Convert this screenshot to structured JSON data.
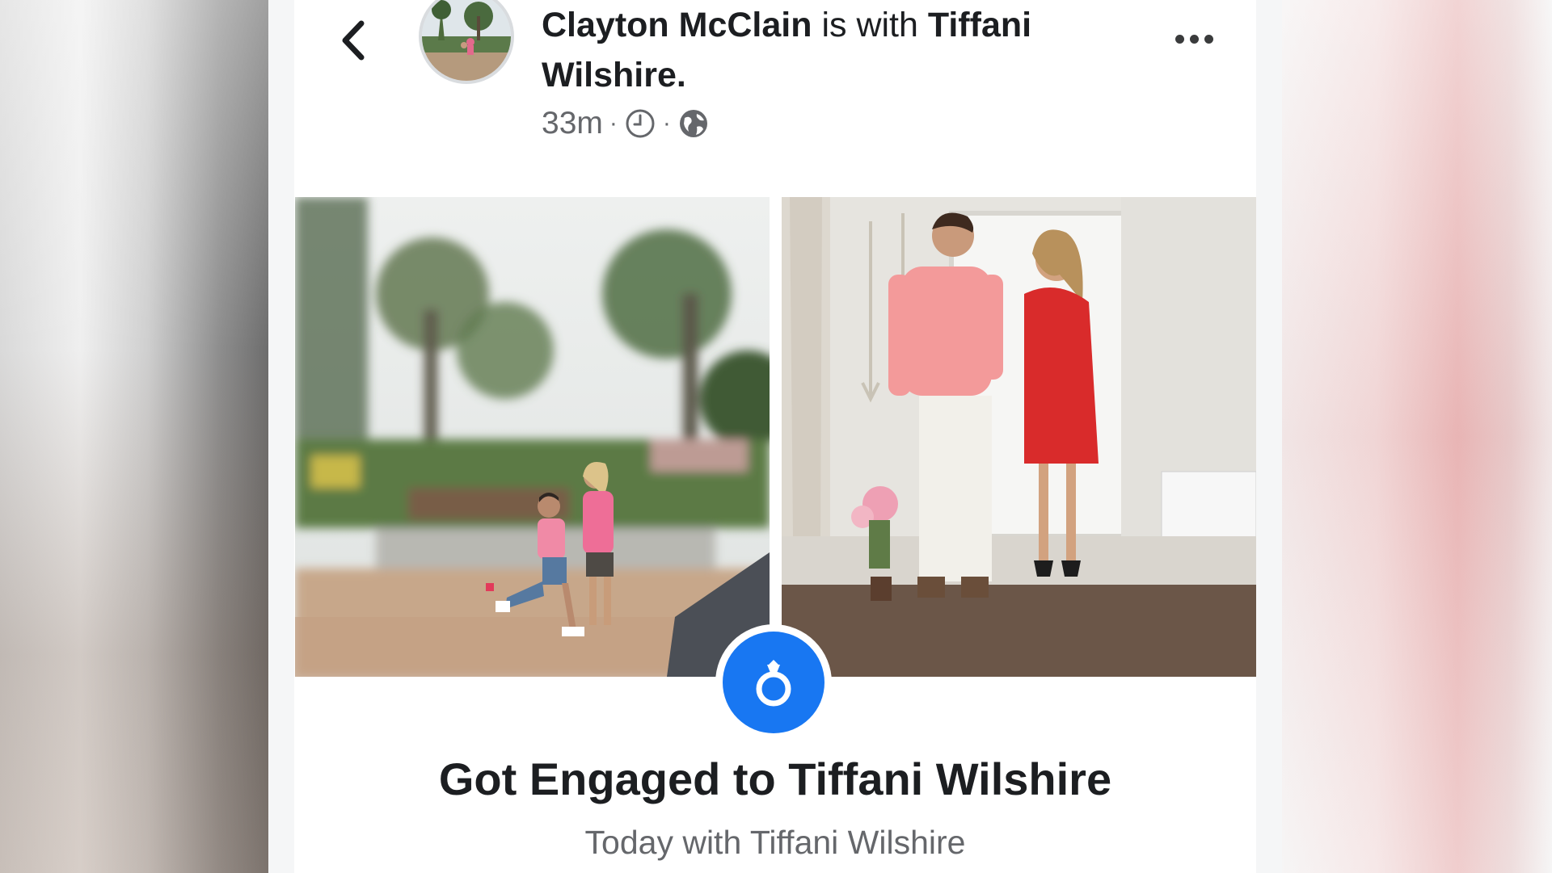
{
  "post": {
    "author": "Clayton McClain",
    "with_connector": "is with",
    "tagged": "Tiffani Wilshire.",
    "time": "33m",
    "separator": "·",
    "more_icon": "more-options-icon",
    "back_icon": "back-chevron-icon"
  },
  "photos": [
    {
      "description_icon": "proposal-photo"
    },
    {
      "description_icon": "couple-photo"
    }
  ],
  "life_event": {
    "icon": "engagement-ring-icon",
    "title": "Got Engaged to Tiffani Wilshire",
    "subtitle": "Today with Tiffani Wilshire"
  },
  "colors": {
    "accent": "#1877f2",
    "text_primary": "#1c1e21",
    "text_secondary": "#65676b"
  }
}
